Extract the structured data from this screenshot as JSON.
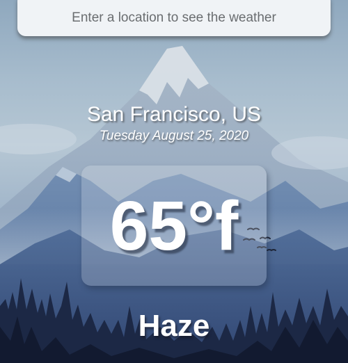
{
  "search": {
    "placeholder": "Enter a location to see the weather",
    "value": ""
  },
  "weather": {
    "location": "San Francisco, US",
    "date": "Tuesday August 25, 2020",
    "temperature": "65°f",
    "condition": "Haze"
  },
  "background": {
    "description_icon": "mountain-forest-background",
    "colors": {
      "sky_top": "#8fa8be",
      "mountain": "#5f7ea8",
      "snow": "#dde3e8",
      "forest": "#1f2c49"
    }
  }
}
